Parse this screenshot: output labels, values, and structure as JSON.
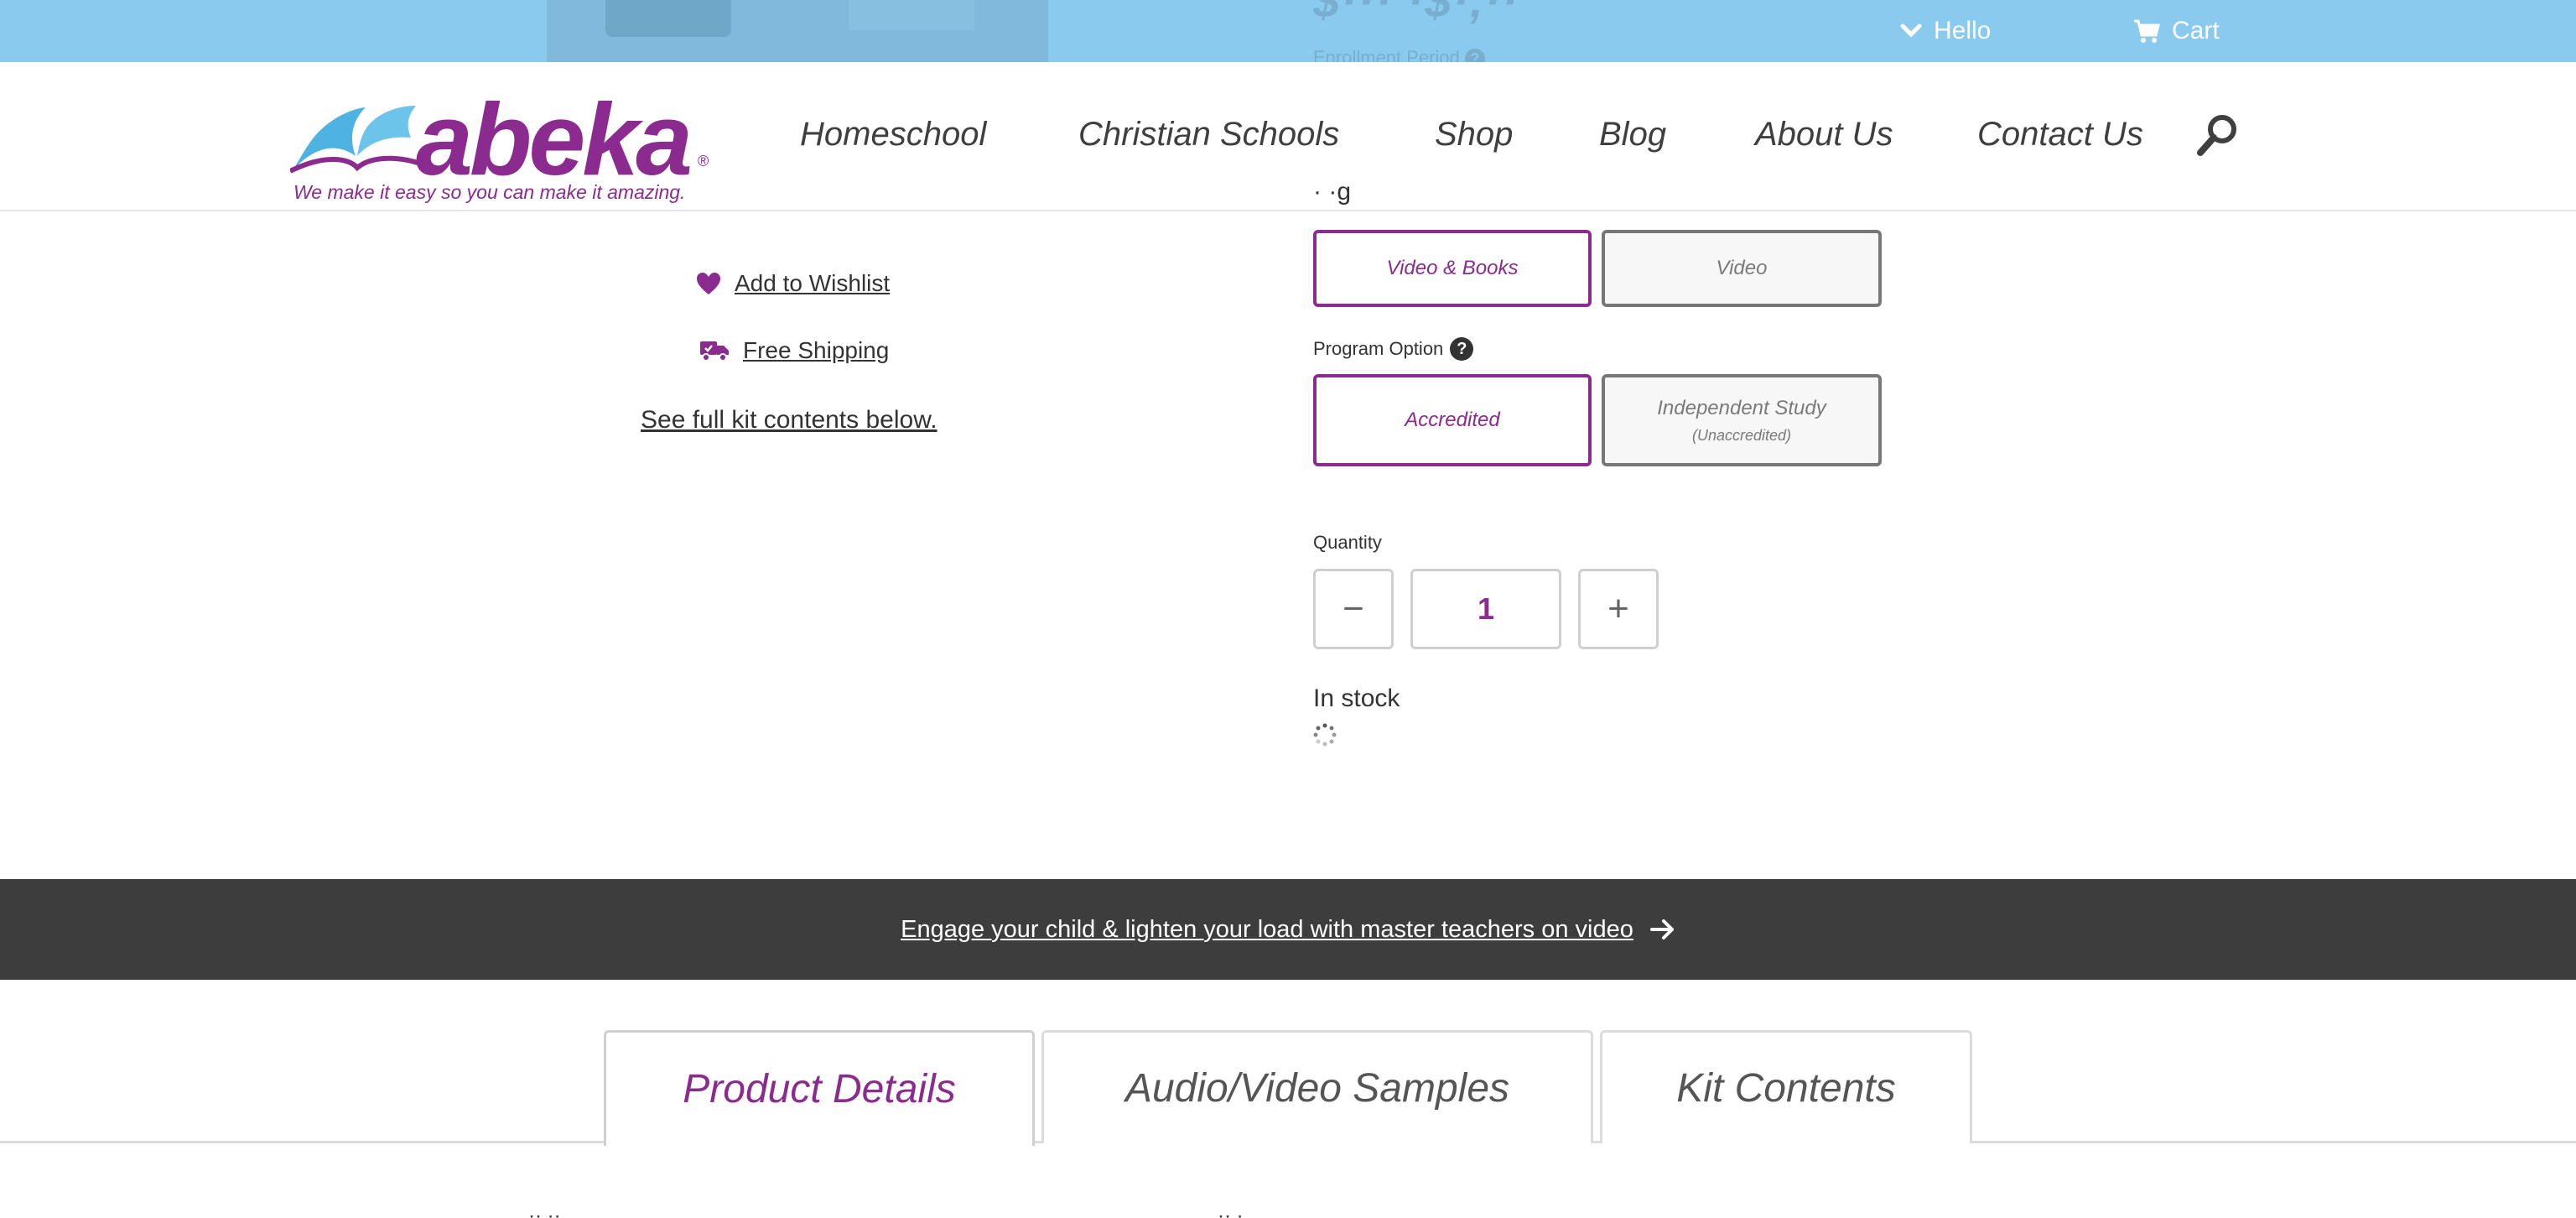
{
  "utility_bar": {
    "hello_label": "Hello",
    "cart_label": "Cart",
    "enrollment_label": "Enrollment Period",
    "hint_icon_text": "?"
  },
  "header": {
    "logo_word": "abeka",
    "logo_reg": "®",
    "tagline": "We make it easy so you can make it amazing.",
    "nav": [
      {
        "label": "Homeschool"
      },
      {
        "label": "Christian Schools"
      },
      {
        "label": "Shop"
      },
      {
        "label": "Blog"
      },
      {
        "label": "About Us"
      },
      {
        "label": "Contact Us"
      }
    ]
  },
  "left_column": {
    "wishlist_label": "Add to Wishlist",
    "shipping_label": "Free Shipping",
    "full_kit_label": "See full kit contents below."
  },
  "options": {
    "format_buttons": [
      {
        "label": "Video & Books",
        "selected": true
      },
      {
        "label": "Video",
        "selected": false
      }
    ],
    "program_label": "Program Option",
    "program_hint": "?",
    "program_buttons": [
      {
        "label": "Accredited",
        "sublabel": "",
        "selected": true
      },
      {
        "label": "Independent Study",
        "sublabel": "(Unaccredited)",
        "selected": false
      }
    ]
  },
  "quantity": {
    "label": "Quantity",
    "value": "1",
    "minus": "−",
    "plus": "+"
  },
  "stock": {
    "status": "In stock"
  },
  "banner": {
    "text": "Engage your child & lighten your load with master teachers on video"
  },
  "tabs": [
    {
      "label": "Product Details",
      "active": true
    },
    {
      "label": "Audio/Video Samples",
      "active": false
    },
    {
      "label": "Kit Contents",
      "active": false
    }
  ],
  "colors": {
    "brand_purple": "#8b2a8f",
    "utility_bar": "#8bcaef",
    "banner_bg": "#3d3d3d",
    "logo_blue": "#4fb3e2"
  }
}
